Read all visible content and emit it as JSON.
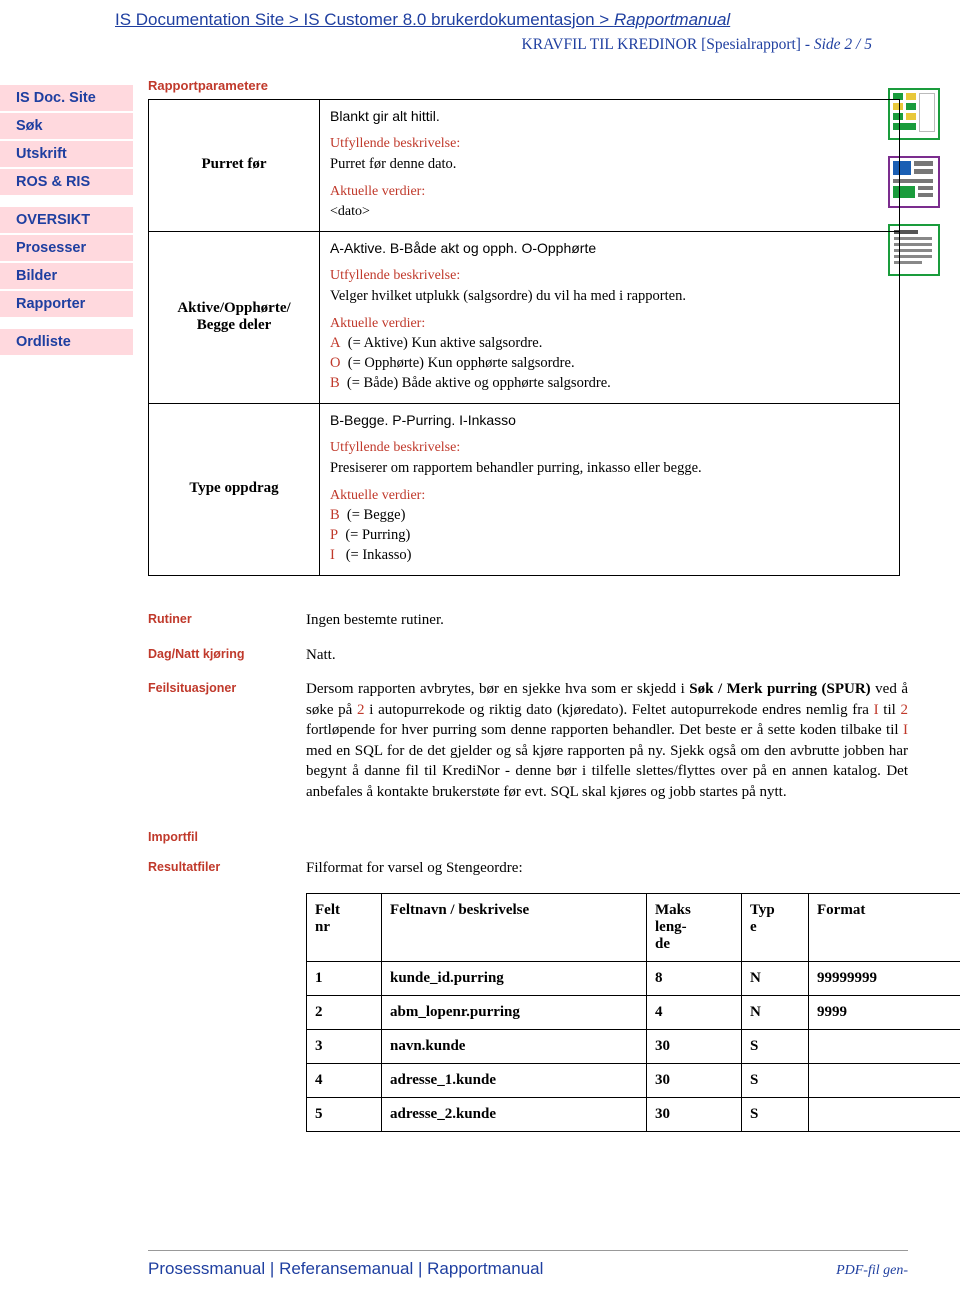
{
  "header": {
    "breadcrumb_plain": "IS Documentation Site > IS Customer 8.0 brukerdokumentasjon > ",
    "breadcrumb_italic": "Rapportmanual",
    "subtitle_main": "KRAVFIL TIL KREDINOR [Spesialrapport] - ",
    "subtitle_page": "Side 2 / 5"
  },
  "sidebar": {
    "items": [
      {
        "label": "IS Doc. Site"
      },
      {
        "label": "Søk"
      },
      {
        "label": "Utskrift"
      },
      {
        "label": "ROS & RIS"
      },
      {
        "label": "OVERSIKT"
      },
      {
        "label": "Prosesser"
      },
      {
        "label": "Bilder"
      },
      {
        "label": "Rapporter"
      },
      {
        "label": "Ordliste"
      }
    ]
  },
  "main": {
    "params_heading": "Rapportparametere",
    "labels": {
      "utfyllende": "Utfyllende beskrivelse:",
      "aktuelle": "Aktuelle verdier:"
    },
    "params": [
      {
        "name": "Purret før",
        "head": "Blankt gir alt hittil.",
        "desc": "Purret før denne dato.",
        "values": [
          {
            "code": "",
            "text": "<dato>"
          }
        ]
      },
      {
        "name": "Aktive/Opphørte/ Begge deler",
        "head": "A-Aktive. B-Både akt og opph. O-Opphørte",
        "desc": "Velger hvilket utplukk (salgsordre) du vil ha med i rapporten.",
        "values": [
          {
            "code": "A",
            "text": "(= Aktive) Kun aktive salgsordre."
          },
          {
            "code": "O",
            "text": "(= Opphørte) Kun opphørte salgsordre."
          },
          {
            "code": "B",
            "text": "(= Både) Både aktive og opphørte salgsordre."
          }
        ]
      },
      {
        "name": "Type oppdrag",
        "head": "B-Begge. P-Purring. I-Inkasso",
        "desc": "Presiserer om rapportem behandler purring, inkasso eller begge.",
        "values": [
          {
            "code": "B",
            "text": "(= Begge)"
          },
          {
            "code": "P",
            "text": "(= Purring)"
          },
          {
            "code": "I",
            "text": "(= Inkasso)"
          }
        ]
      }
    ],
    "rows": [
      {
        "label": "Rutiner",
        "text": "Ingen bestemte rutiner."
      },
      {
        "label": "Dag/Natt kjøring",
        "text": "Natt."
      },
      {
        "label": "Feilsituasjoner",
        "text": ""
      },
      {
        "label": "Importfil",
        "text": ""
      },
      {
        "label": "Resultatfiler",
        "text": "Filformat for varsel og Stengeordre:"
      }
    ],
    "feilsituasjoner_text": "Dersom rapporten avbrytes, bør en sjekke hva som er skjedd i Søk / Merk purring (SPUR) ved å søke på 2 i autopurrekode og riktig dato (kjøredato). Feltet autopurrekode endres nemlig fra I til 2 fortløpende for hver purring som denne rapporten behandler. Det beste er å sette koden tilbake til I med en SQL for de det gjelder og så kjøre rapporten på ny. Sjekk også om den avbrutte jobben har begynt å danne fil til KrediNor - denne bør i tilfelle slettes/flyttes over på en annen katalog. Det anbefales å kontakte brukerstøte før evt. SQL skal kjøres og jobb startes på nytt.",
    "result_table": {
      "headers": [
        "Felt nr",
        "Feltnavn / beskrivelse",
        "Maks leng- de",
        "Typ e",
        "Format"
      ],
      "rows": [
        [
          "1",
          "kunde_id.purring",
          "8",
          "N",
          "99999999"
        ],
        [
          "2",
          "abm_lopenr.purring",
          "4",
          "N",
          "9999"
        ],
        [
          "3",
          "navn.kunde",
          "30",
          "S",
          ""
        ],
        [
          "4",
          "adresse_1.kunde",
          "30",
          "S",
          ""
        ],
        [
          "5",
          "adresse_2.kunde",
          "30",
          "S",
          ""
        ]
      ]
    }
  },
  "footer": {
    "link1": "Prosessmanual",
    "sep": "|",
    "link2": "Referansemanual",
    "link3": "Rapportmanual",
    "right": "PDF-fil gen-"
  },
  "icons": [
    {
      "name": "document-grid-icon"
    },
    {
      "name": "document-layout-icon"
    },
    {
      "name": "document-text-icon"
    }
  ]
}
